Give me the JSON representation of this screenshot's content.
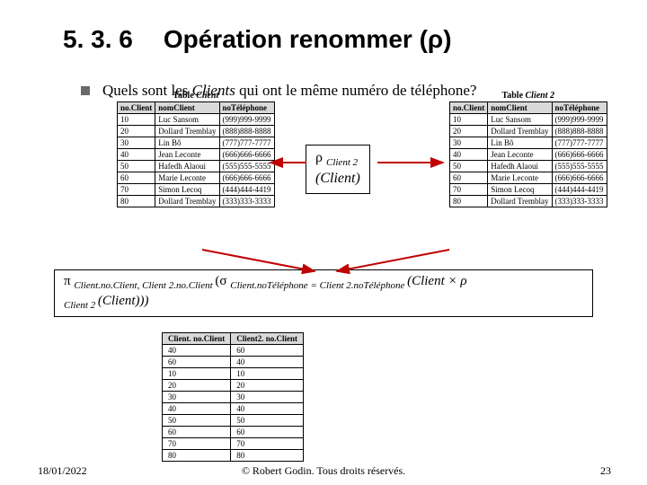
{
  "section_number": "5. 3. 6",
  "title": "Opération renommer (ρ)",
  "question_prefix": "Quels sont les ",
  "question_emph": "Clients",
  "question_suffix": " qui ont le même numéro de téléphone?",
  "table_left_caption_prefix": "Table ",
  "table_left_caption_em": "Client",
  "table_right_caption_prefix": "Table ",
  "table_right_caption_em": "Client 2",
  "columns": [
    "no.Client",
    "nomClient",
    "noTéléphone"
  ],
  "rows": [
    [
      "10",
      "Luc Sansom",
      "(999)999-9999"
    ],
    [
      "20",
      "Dollard Tremblay",
      "(888)888-8888"
    ],
    [
      "30",
      "Lin Bô",
      "(777)777-7777"
    ],
    [
      "40",
      "Jean Leconte",
      "(666)666-6666"
    ],
    [
      "50",
      "Hafedh Alaoui",
      "(555)555-5555"
    ],
    [
      "60",
      "Marie Leconte",
      "(666)666-6666"
    ],
    [
      "70",
      "Simon Lecoq",
      "(444)444-4419"
    ],
    [
      "80",
      "Dollard Tremblay",
      "(333)333-3333"
    ]
  ],
  "midbox_line1_sub": "Client 2",
  "midbox_line2": "(Client)",
  "formula_sub1": "Client.no.Client, Client 2.no.Client ",
  "formula_sub2": "Client.noTéléphone = Client 2.noTéléphone ",
  "formula_tail1": "(Client × ρ",
  "formula_line2_sub": "Client 2 ",
  "formula_line2_tail": "(Client)))",
  "result_headers": [
    "Client. no.Client",
    "Client2. no.Client"
  ],
  "result_rows": [
    [
      "40",
      "60"
    ],
    [
      "60",
      "40"
    ],
    [
      "10",
      "10"
    ],
    [
      "20",
      "20"
    ],
    [
      "30",
      "30"
    ],
    [
      "40",
      "40"
    ],
    [
      "50",
      "50"
    ],
    [
      "60",
      "60"
    ],
    [
      "70",
      "70"
    ],
    [
      "80",
      "80"
    ]
  ],
  "footer_date": "18/01/2022",
  "footer_center": "© Robert Godin. Tous droits réservés.",
  "footer_page": "23"
}
